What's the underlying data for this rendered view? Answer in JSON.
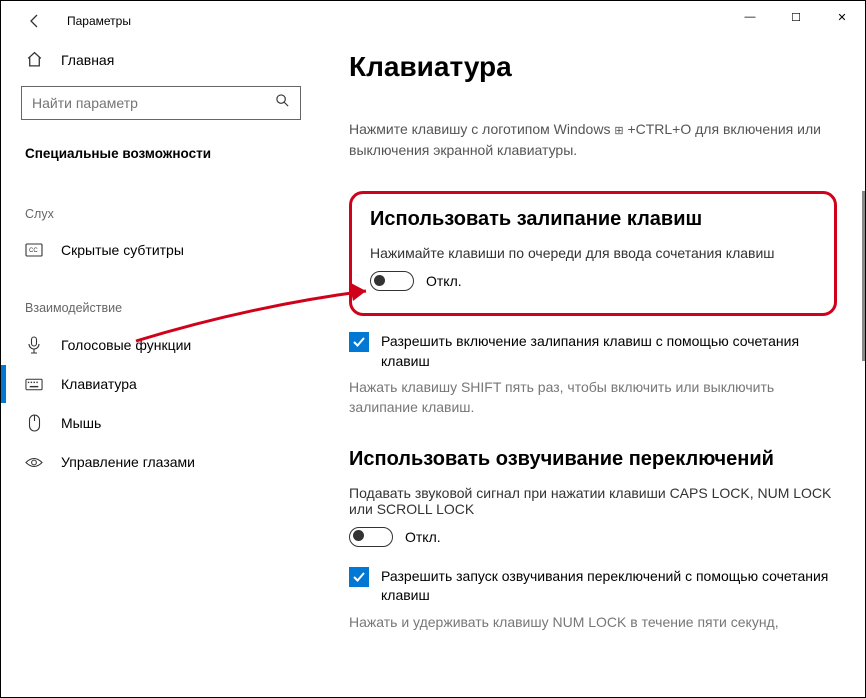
{
  "app_title": "Параметры",
  "win": {
    "min": "—",
    "max": "☐",
    "close": "✕"
  },
  "sidebar": {
    "home": "Главная",
    "search_placeholder": "Найти параметр",
    "section": "Специальные возможности",
    "group_hearing": "Слух",
    "item_captions": "Скрытые субтитры",
    "group_interaction": "Взаимодействие",
    "item_speech": "Голосовые функции",
    "item_keyboard": "Клавиатура",
    "item_mouse": "Мышь",
    "item_eye": "Управление глазами"
  },
  "content": {
    "title": "Клавиатура",
    "osk_help_pre": "Нажмите клавишу с логотипом Windows ",
    "osk_help_post": " +CTRL+O для включения или выключения экранной клавиатуры.",
    "sticky": {
      "heading": "Использовать залипание клавиш",
      "desc": "Нажимайте клавиши по очереди для ввода сочетания клавиш",
      "state": "Откл.",
      "check_label": "Разрешить включение залипания клавиш с помощью сочетания клавиш",
      "check_help": "Нажать клавишу SHIFT пять раз, чтобы включить или выключить залипание клавиш."
    },
    "toggkeys": {
      "heading": "Использовать озвучивание переключений",
      "desc": "Подавать звуковой сигнал при нажатии клавиши CAPS LOCK, NUM LOCK или SCROLL LOCK",
      "state": "Откл.",
      "check_label": "Разрешить запуск озвучивания переключений с помощью сочетания клавиш",
      "check_help": "Нажать и удерживать клавишу NUM LOCK в течение пяти секунд,"
    }
  }
}
